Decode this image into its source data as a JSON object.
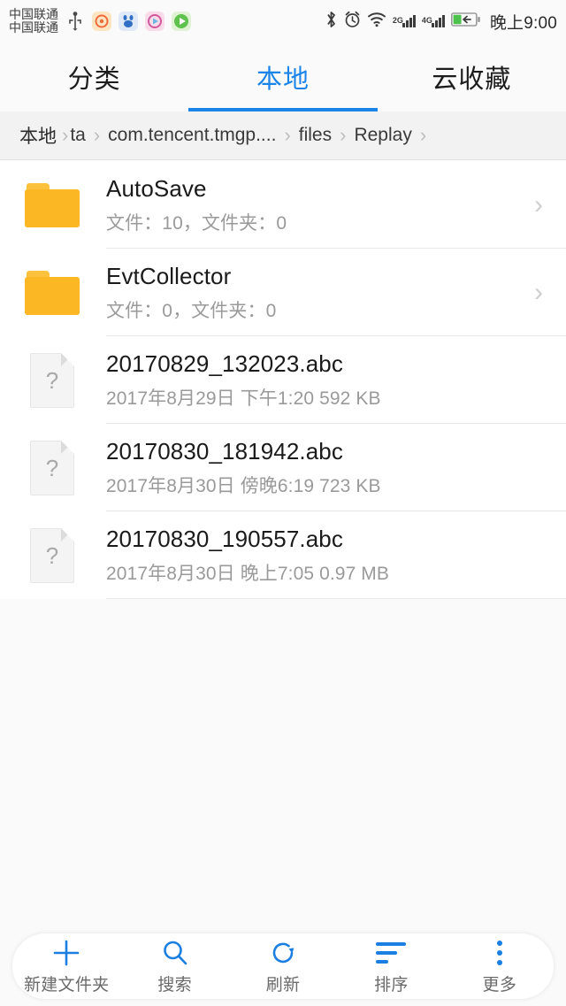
{
  "statusbar": {
    "carrier_line1": "中国联通",
    "carrier_line2": "中国联通",
    "usb_icon": "usb-icon",
    "app_icons": [
      {
        "name": "weibo-notification-icon",
        "color": "#f5a623"
      },
      {
        "name": "baidu-notification-icon",
        "color": "#3b7fd4"
      },
      {
        "name": "media-notification-icon",
        "color": "#e05fa0"
      },
      {
        "name": "play-notification-icon",
        "color": "#5fc14e"
      }
    ],
    "bluetooth_icon": "bluetooth-icon",
    "alarm_icon": "alarm-icon",
    "wifi_icon": "wifi-icon",
    "sim1_label": "2G",
    "sim2_label": "4G",
    "battery_icon": "battery-charging-icon",
    "time": "晚上9:00"
  },
  "tabs": [
    {
      "label": "分类",
      "active": false
    },
    {
      "label": "本地",
      "active": true
    },
    {
      "label": "云收藏",
      "active": false
    }
  ],
  "breadcrumb": {
    "separator": "›",
    "items": [
      "本地",
      "ta",
      "com.tencent.tmgp....",
      "files",
      "Replay"
    ]
  },
  "list": [
    {
      "type": "folder",
      "icon": "folder-icon",
      "name": "AutoSave",
      "detail": "文件：10，文件夹：0",
      "chevron": "›"
    },
    {
      "type": "folder",
      "icon": "folder-icon",
      "name": "EvtCollector",
      "detail": "文件：0，文件夹：0",
      "chevron": "›"
    },
    {
      "type": "file",
      "icon": "unknown-file-icon",
      "icon_glyph": "?",
      "name": "20170829_132023.abc",
      "detail": "2017年8月29日 下午1:20 592 KB"
    },
    {
      "type": "file",
      "icon": "unknown-file-icon",
      "icon_glyph": "?",
      "name": "20170830_181942.abc",
      "detail": "2017年8月30日 傍晚6:19 723 KB"
    },
    {
      "type": "file",
      "icon": "unknown-file-icon",
      "icon_glyph": "?",
      "name": "20170830_190557.abc",
      "detail": "2017年8月30日 晚上7:05 0.97 MB"
    }
  ],
  "toolbar": [
    {
      "label": "新建文件夹",
      "icon": "plus-icon"
    },
    {
      "label": "搜索",
      "icon": "search-icon"
    },
    {
      "label": "刷新",
      "icon": "refresh-icon"
    },
    {
      "label": "排序",
      "icon": "sort-icon"
    },
    {
      "label": "更多",
      "icon": "more-vertical-icon"
    }
  ],
  "colors": {
    "accent": "#1a84e8",
    "toolbar_icon": "#1a7fe0",
    "folder": "#fbb724",
    "page_bg": "#fafafa",
    "crumb_bg": "#f2f2f2"
  }
}
